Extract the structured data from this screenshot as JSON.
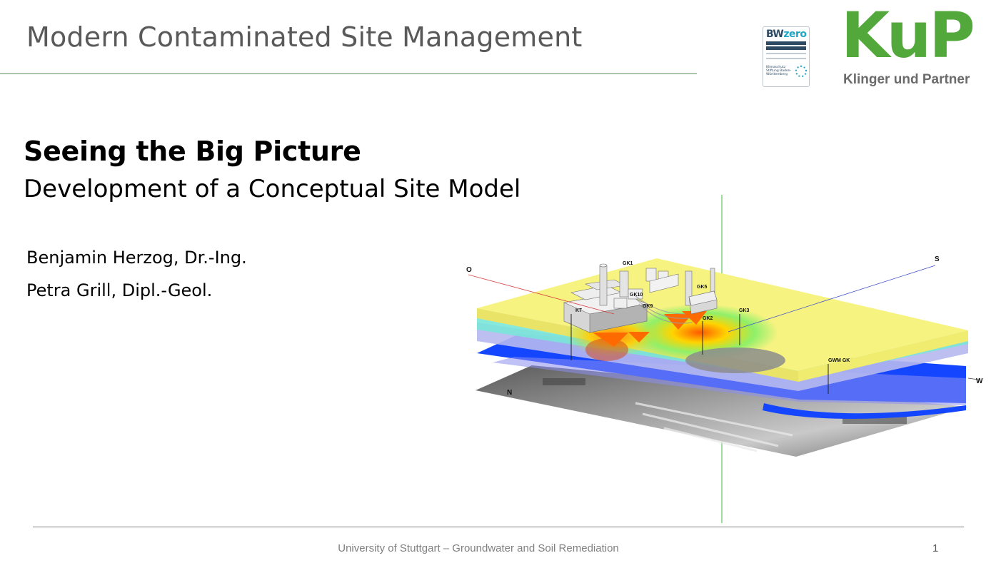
{
  "header": {
    "title": "Modern Contaminated Site Management"
  },
  "badge": {
    "line1_prefix": "BW",
    "line1_suffix": "zero",
    "small_text": "Klimaschutz Stiftung Baden-Württemberg"
  },
  "logo": {
    "main": "KuP",
    "sub": "Klinger und Partner"
  },
  "slide": {
    "heading": "Seeing the Big Picture",
    "subheading": "Development of a Conceptual Site Model",
    "authors": [
      "Benjamin Herzog, Dr.-Ing.",
      "Petra Grill, Dipl.-Geol."
    ]
  },
  "model": {
    "axis_labels": {
      "o": "O",
      "s": "S",
      "w": "W",
      "n": "N"
    },
    "well_labels": {
      "gk1": "GK1",
      "gk2": "GK2",
      "gk3": "GK3",
      "gk5": "GK5",
      "gk9": "GK9",
      "gk10": "GK10",
      "k7": "K7",
      "gwm": "GWM GK"
    },
    "colors": {
      "surface": "#f7f380",
      "groundwater": "#1446ff",
      "plume_hot": "#ff6a00",
      "plume_mid": "#ffd400",
      "plume_low": "#6bea6b",
      "green_axis": "#3dbb3d"
    }
  },
  "footer": {
    "text": "University of Stuttgart – Groundwater and Soil Remediation",
    "page": "1"
  }
}
